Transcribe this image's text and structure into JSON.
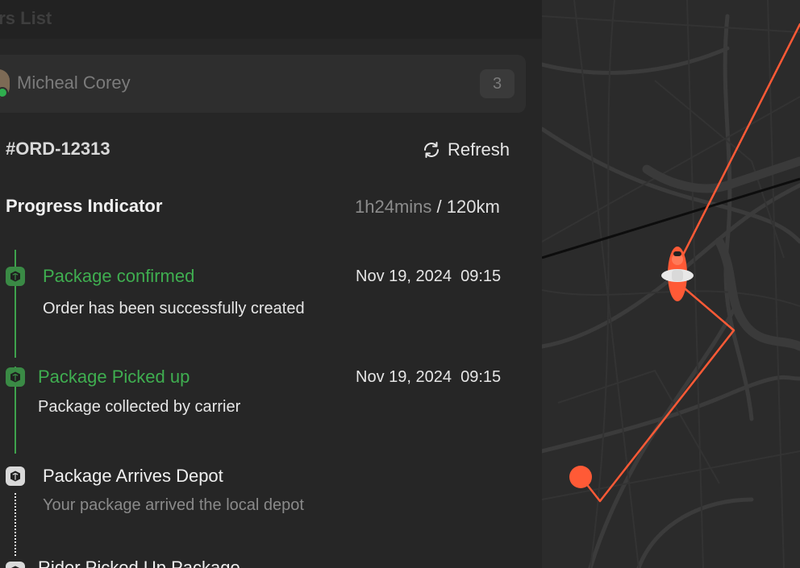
{
  "header": {
    "title": "ers List"
  },
  "customer": {
    "name": "Micheal Corey",
    "count": "3"
  },
  "order": {
    "id": "#ORD-12313",
    "refresh_label": "Refresh"
  },
  "progress": {
    "title": "Progress Indicator",
    "time": "1h24mins",
    "separator": " / ",
    "distance": "120km"
  },
  "steps": [
    {
      "title": "Package confirmed",
      "description": "Order has been successfully created",
      "date": "Nov 19, 2024  09:15",
      "status": "done",
      "icon": "package-icon"
    },
    {
      "title": "Package Picked up",
      "description": "Package collected by carrier",
      "date": "Nov 19, 2024  09:15",
      "status": "done",
      "icon": "package-icon"
    },
    {
      "title": "Package Arrives Depot",
      "description": "Your package arrived the local depot",
      "date": "",
      "status": "pending",
      "icon": "package-icon"
    },
    {
      "title": "Rider Picked Up Package",
      "description": "",
      "date": "",
      "status": "pending",
      "icon": "package-icon"
    }
  ],
  "map": {
    "route_color": "#ff5a36",
    "icons": [
      "rider-marker-icon",
      "destination-pin-icon"
    ]
  },
  "colors": {
    "accent_green": "#3fae50",
    "route_orange": "#ff5a36",
    "background": "#262626"
  }
}
